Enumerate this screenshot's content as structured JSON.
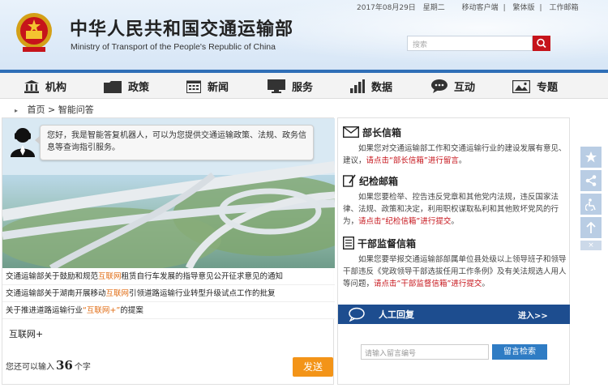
{
  "header": {
    "title": "中华人民共和国交通运输部",
    "subtitle": "Ministry of Transport of the People's Republic of China",
    "date": "2017年08月29日",
    "weekday": "星期二",
    "links": [
      "移动客户端",
      "繁体版",
      "工作邮箱"
    ],
    "search_placeholder": "搜索"
  },
  "nav": {
    "items": [
      {
        "label": "机构",
        "icon": "building-icon"
      },
      {
        "label": "政策",
        "icon": "folder-icon"
      },
      {
        "label": "新闻",
        "icon": "calendar-icon"
      },
      {
        "label": "服务",
        "icon": "monitor-icon"
      },
      {
        "label": "数据",
        "icon": "bar-chart-icon"
      },
      {
        "label": "互动",
        "icon": "chat-icon"
      },
      {
        "label": "专题",
        "icon": "picture-icon"
      }
    ]
  },
  "breadcrumb": {
    "home": "首页",
    "separator": ">",
    "current": "智能问答"
  },
  "chat": {
    "greeting": "您好，我是智能答复机器人，可以为您提供交通运输政策、法规、政务信息等查询指引服务。",
    "questions": [
      {
        "before": "交通运输部关于鼓励和规范",
        "highlight": "互联网",
        "after": "租赁自行车发展的指导意见公开征求意见的通知"
      },
      {
        "before": "交通运输部关于湖南开展移动",
        "highlight": "互联网",
        "after": "引领道路运输行业转型升级试点工作的批复"
      },
      {
        "before": "关于推进道路运输行业",
        "highlight": "“互联网+”",
        "after": "的提案"
      }
    ],
    "input_value": "互联网+",
    "counter_prefix": "您还可以输入",
    "counter_value": "36",
    "counter_suffix": "个字",
    "send_label": "发送"
  },
  "mailboxes": [
    {
      "title": "部长信箱",
      "icon": "envelope-icon",
      "body": "如果您对交通运输部工作和交通运输行业的建设发展有意见、建议，",
      "link": "请点击“部长信箱”进行留言",
      "end": "。"
    },
    {
      "title": "纪检邮箱",
      "icon": "pen-doc-icon",
      "body": "如果您要检举、控告违反党章和其他党内法规，违反国家法律、法规、政策和决定，利用职权谋取私利和其他败坏党风的行为，",
      "link": "请点击“纪检信箱”进行提交",
      "end": "。"
    },
    {
      "title": "干部监督信箱",
      "icon": "document-icon",
      "body": "如果您要举报交通运输部部属单位县处级以上领导班子和领导干部违反《党政领导干部选拔任用工作条例》及有关法规选人用人等问题，",
      "link": "请点击“干部监督信箱”进行提交",
      "end": "。"
    }
  ],
  "reply": {
    "title": "人工回复",
    "enter": "进入>>",
    "input_placeholder": "请输入留言编号",
    "button": "留言检索"
  },
  "tools": [
    "star-icon",
    "share-icon",
    "accessibility-icon",
    "up-arrow-icon"
  ],
  "tools_close": "×",
  "colors": {
    "brand_blue": "#1d4d8f",
    "accent_orange": "#f39418",
    "red": "#c6141b"
  }
}
